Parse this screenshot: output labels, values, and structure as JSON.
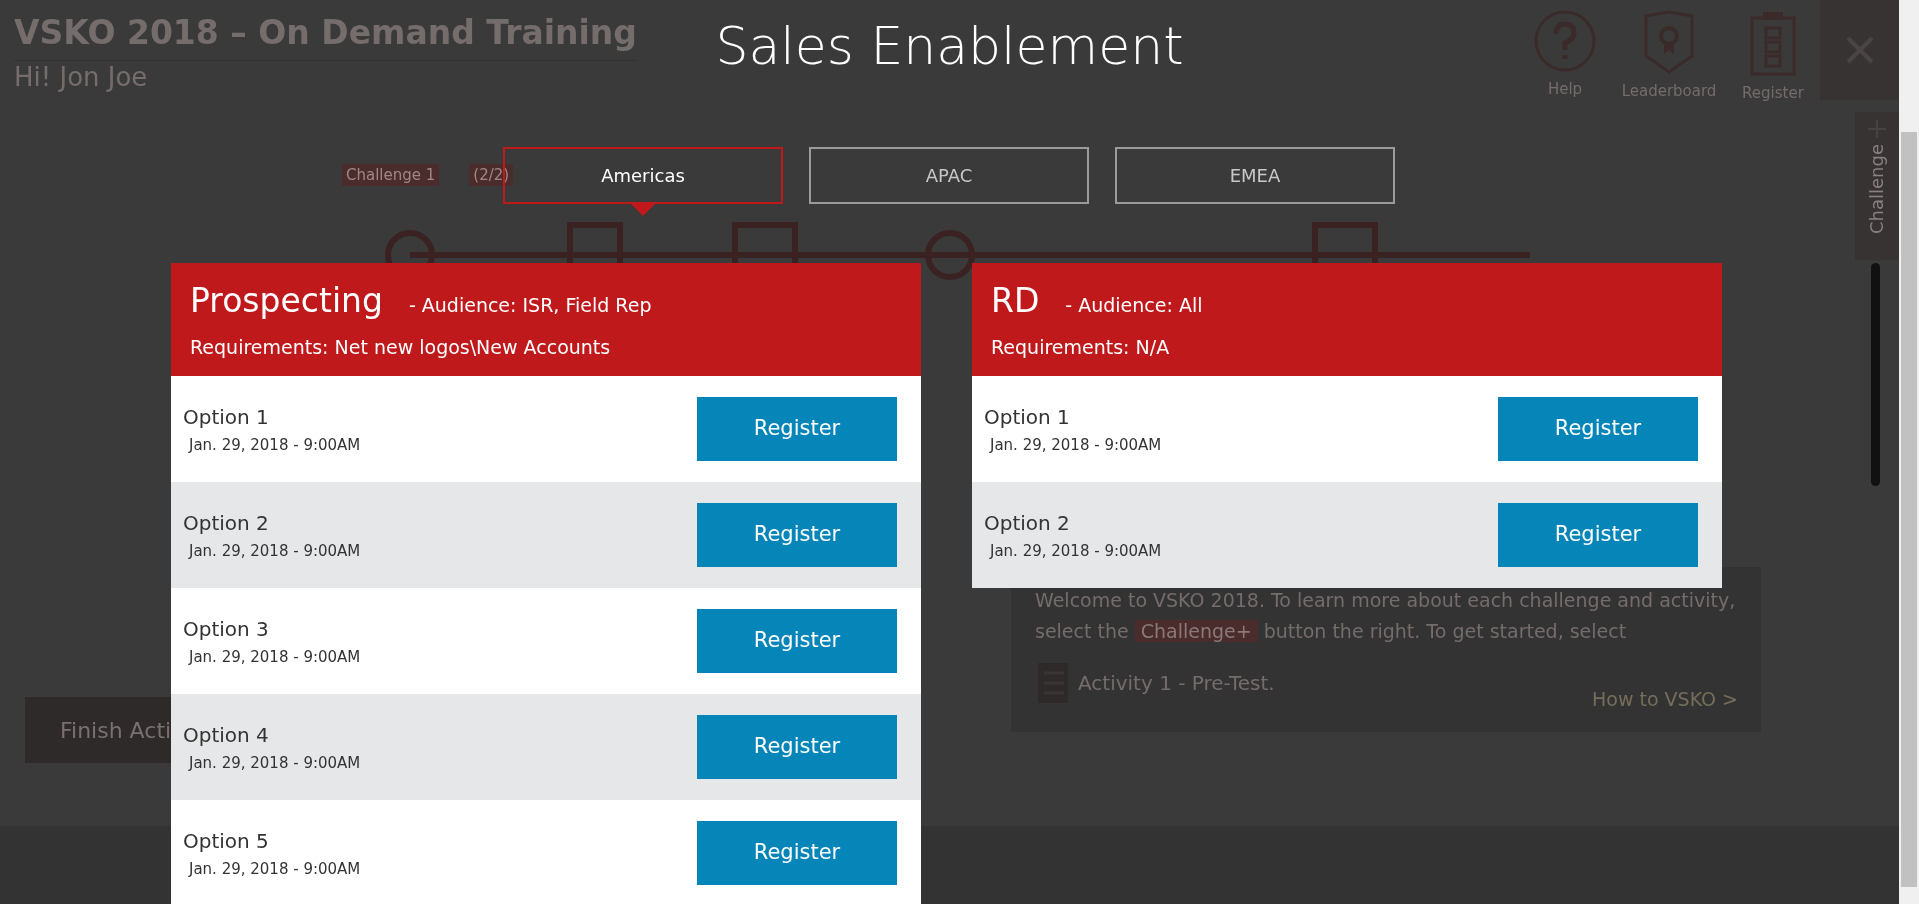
{
  "background": {
    "title": "VSKO 2018 – On Demand Training",
    "greeting": "Hi! Jon Joe",
    "header_actions": [
      {
        "kind": "help",
        "label": "Help"
      },
      {
        "kind": "leaderboard",
        "label": "Leaderboard"
      },
      {
        "kind": "register",
        "label": "Register"
      }
    ],
    "side_tab": {
      "label": "Challenge"
    },
    "challenge_labels": [
      {
        "name": "Challenge 1",
        "progress": "(2/2)"
      }
    ],
    "welcome": {
      "text_before": "Welcome to VSKO 2018. To learn more about each challenge and activity, select the",
      "badge": "Challenge+",
      "text_after": "button the right. To get started, select",
      "activity": "Activity 1 - Pre-Test.",
      "link": "How to VSKO >"
    },
    "finish_button": "Finish Acti"
  },
  "modal": {
    "title": "Sales Enablement",
    "tabs": [
      {
        "label": "Americas",
        "selected": true
      },
      {
        "label": "APAC",
        "selected": false
      },
      {
        "label": "EMEA",
        "selected": false
      }
    ],
    "sessions": [
      {
        "title": "Prospecting",
        "audience": "- Audience: ISR, Field Rep",
        "requirements": "Requirements: Net new logos\\New Accounts",
        "options": [
          {
            "label": "Option 1",
            "date": "Jan. 29, 2018 - 9:00AM",
            "button": "Register"
          },
          {
            "label": "Option 2",
            "date": "Jan. 29, 2018 - 9:00AM",
            "button": "Register"
          },
          {
            "label": "Option 3",
            "date": "Jan. 29, 2018 - 9:00AM",
            "button": "Register"
          },
          {
            "label": "Option 4",
            "date": "Jan. 29, 2018 - 9:00AM",
            "button": "Register"
          },
          {
            "label": "Option 5",
            "date": "Jan. 29, 2018 - 9:00AM",
            "button": "Register"
          }
        ]
      },
      {
        "title": "RD",
        "audience": "- Audience: All",
        "requirements": "Requirements: N/A",
        "options": [
          {
            "label": "Option 1",
            "date": "Jan. 29, 2018 - 9:00AM",
            "button": "Register"
          },
          {
            "label": "Option 2",
            "date": "Jan. 29, 2018 - 9:00AM",
            "button": "Register"
          }
        ]
      }
    ]
  }
}
